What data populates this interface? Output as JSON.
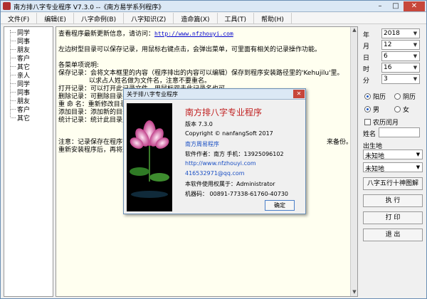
{
  "window": {
    "title": "南方排八字专业程序 V7.3.0 --《南方易学系列程序》"
  },
  "menu": [
    "文件(F)",
    "编辑(E)",
    "八字命例(B)",
    "八字知识(Z)",
    "造命篇(X)",
    "工具(T)",
    "帮助(H)"
  ],
  "tree": [
    "同学",
    "同事",
    "朋友",
    "客户",
    "其它",
    "亲人",
    "同学",
    "同事",
    "朋友",
    "客户",
    "其它"
  ],
  "editor": {
    "l1_text": "查看程序最新更新信息，请访问：",
    "l1_link": "http://www.nfzhouyi.com",
    "l2": "左边树型目录可以保存记录，用鼠标右键点击，会弹出菜单，可里面有相关的记录操作功能。",
    "l3": "各菜单项说明:",
    "l4": "保存记录：会将文本框里的内容（程序排出的内容可以编辑）保存到程序安装路径里的'Kehujilu'里。",
    "l5": "以求占人姓名做为文件名，注意不要重名。",
    "l6": "打开记录：可以打开此记录文件，用鼠标双击此记录名也可。",
    "l7": "删除记录：可删除目录名",
    "l8": "重 命 名：重新修改目录",
    "l9": "添加目录：添加新的目录",
    "l10": "统计记录：统计此目录里",
    "l11": "注意：记录保存在程序安",
    "l11_tail": "来备份。",
    "l12": "重新安装程序后，再将这"
  },
  "panel": {
    "fields": [
      {
        "label": "年",
        "value": "2018"
      },
      {
        "label": "月",
        "value": "12"
      },
      {
        "label": "日",
        "value": "6"
      },
      {
        "label": "时",
        "value": "16"
      },
      {
        "label": "分",
        "value": "3"
      }
    ],
    "calendar": {
      "solar": "阳历",
      "lunar": "阴历",
      "selected": "solar"
    },
    "gender": {
      "male": "男",
      "female": "女",
      "selected": "male"
    },
    "leap_month": "农历闰月",
    "name_label": "姓名",
    "birthplace_label": "出生地",
    "unknown1": "未知地",
    "unknown2": "未知地",
    "btn_chart": "八字五行十神图解",
    "btn_run": "执 行",
    "btn_print": "打 印",
    "btn_exit": "退 出"
  },
  "dialog": {
    "title": "关于排八字专业程序",
    "heading": "南方排八字专业程序",
    "version": "版本 7.3.0",
    "copyright": "Copyright © nanfangSoft 2017",
    "website_name": "南方周易程序",
    "author": "软件作者：南方     手机：13925096102",
    "url": "http://www.nfzhouyi.com",
    "email": "416532971@qq.com",
    "license": "本软件使用权属于：Administrator",
    "machine": "机器码：   00891-77338-61760-40730",
    "ok": "确定"
  },
  "colors": {
    "titlebar": "#dbe8f5",
    "close": "#c7473b",
    "editor_bg": "#fffff0",
    "link": "#0000cc",
    "heading_red": "#c02020"
  }
}
